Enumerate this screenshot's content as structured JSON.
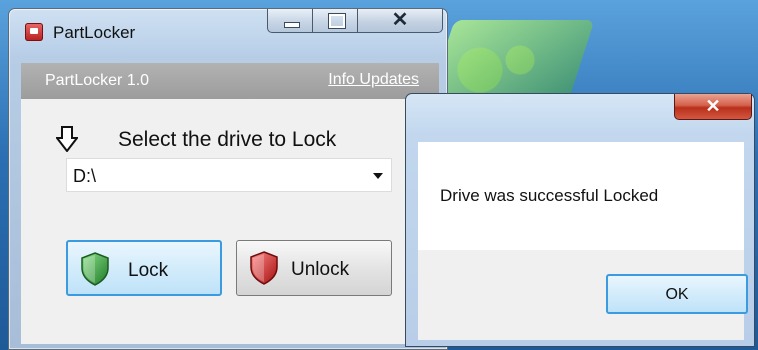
{
  "window": {
    "title": "PartLocker",
    "header_title": "PartLocker 1.0",
    "header_link": "Info Updates"
  },
  "main": {
    "prompt": "Select the drive to Lock",
    "drive_value": "D:\\",
    "lock_button": "Lock",
    "unlock_button": "Unlock"
  },
  "dialog": {
    "message": "Drive was successful Locked",
    "ok_button": "OK"
  },
  "icons": {
    "app": "partlocker-app-icon",
    "arrow": "down-arrow-icon",
    "lock_shield": "green-shield-icon",
    "unlock_shield": "red-shield-icon",
    "close": "close-icon",
    "minimize": "minimize-icon",
    "maximize": "maximize-icon"
  },
  "colors": {
    "accent": "#3a9be0",
    "close_red": "#c0402a",
    "shield_green": "#2f9a3a",
    "shield_red": "#c81b1b"
  }
}
